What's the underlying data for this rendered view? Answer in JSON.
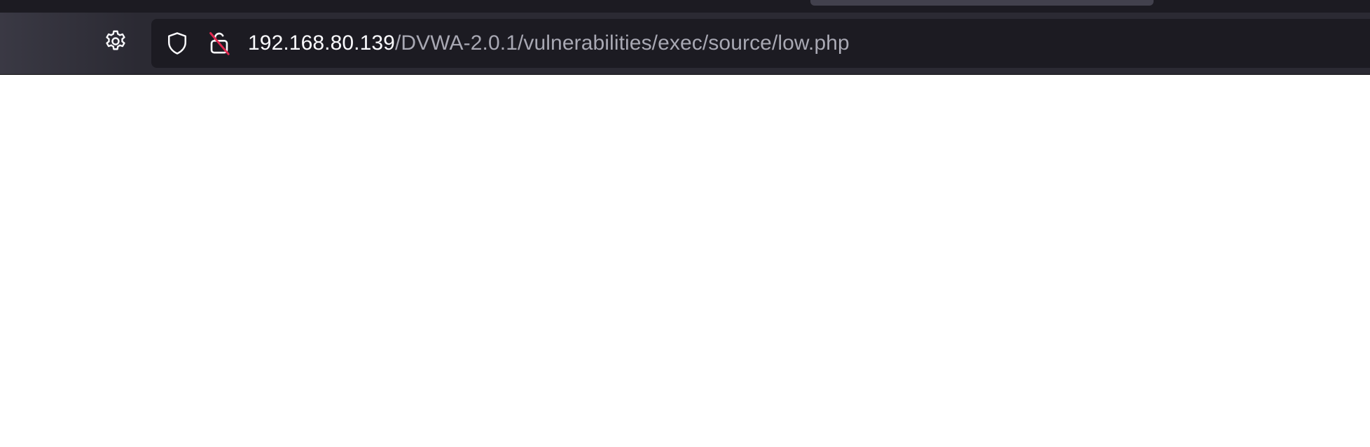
{
  "browser": {
    "url": {
      "host": "192.168.80.139",
      "path": "/DVWA-2.0.1/vulnerabilities/exec/source/low.php"
    },
    "icons": {
      "settings": "gear-icon",
      "tracking_protection": "shield-icon",
      "connection": "insecure-lock-icon"
    },
    "colors": {
      "chrome": "#2b2a33",
      "urlbar": "#1c1b22",
      "host_text": "#fbfbfe",
      "path_text": "#a8a8b3",
      "insecure_strike": "#e22850"
    }
  },
  "page": {
    "background": "#ffffff"
  }
}
